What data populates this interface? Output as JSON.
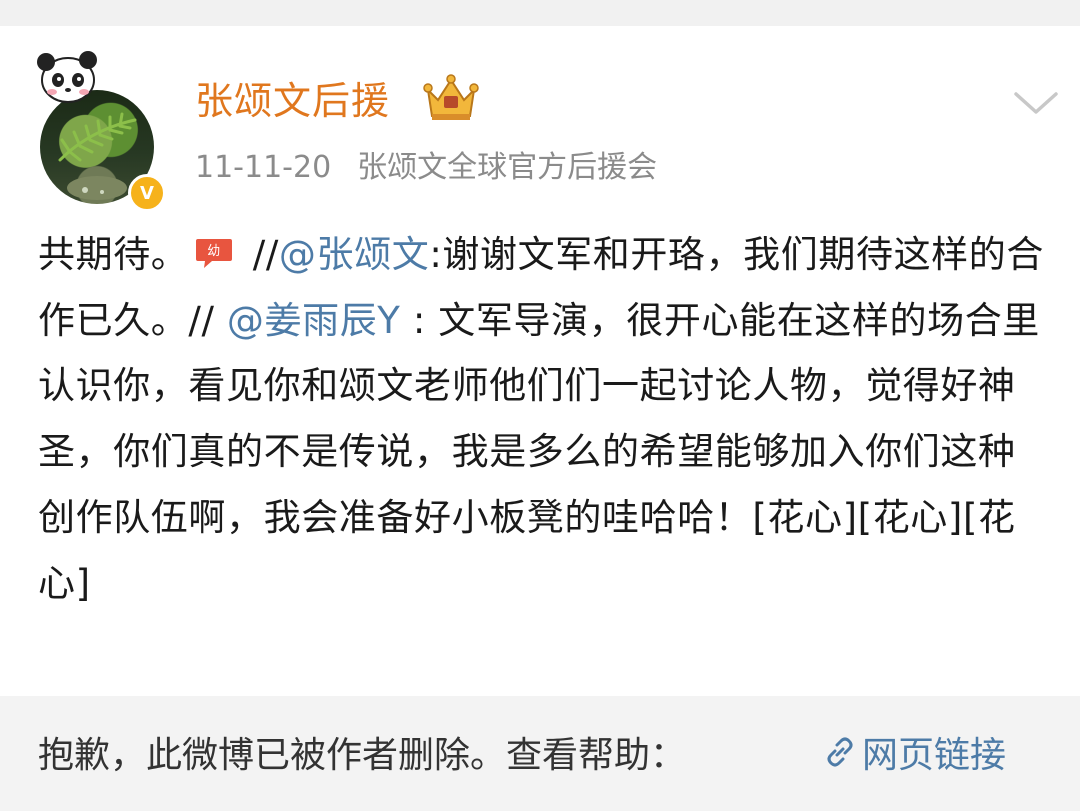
{
  "post": {
    "username": "张颂文后援",
    "time": "11-11-20",
    "source": "张颂文全球官方后援会",
    "text_start": "共期待。",
    "sep1": " //",
    "mention1": "@张颂文",
    "text_mid": ":谢谢文军和开珞，我们期待这样的合作已久。// ",
    "mention2": "@姜雨辰Y",
    "text_end": " : 文军导演，很开心能在这样的场合里认识你，看见你和颂文老师他们们一起讨论人物，觉得好神圣，你们真的不是传说，我是多么的希望能够加入你们这种创作队伍啊，我会准备好小板凳的哇哈哈！[花心][花心][花心]"
  },
  "deleted_notice": {
    "text": "抱歉，此微博已被作者删除。查看帮助：",
    "link_label": "网页链接"
  },
  "icons": {
    "badge": "verified-v-icon",
    "crown": "crown-icon",
    "menu": "chevron-down-icon",
    "emoji": "gif-emoji-icon",
    "link": "link-icon"
  },
  "colors": {
    "username": "#e0771e",
    "mention": "#4d7ba7",
    "meta": "#8b8b8b",
    "badge": "#f6b21b"
  }
}
